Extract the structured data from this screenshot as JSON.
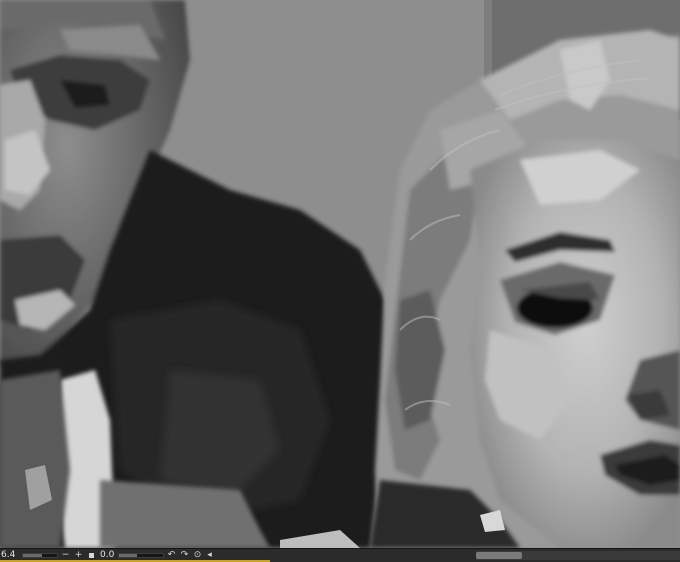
{
  "canvas": {
    "description_icon": "painting-canvas",
    "colors": {
      "background_wall": "#8d8d8d",
      "coat": "#1b1b1b",
      "face_light": "#c6c6c6"
    }
  },
  "statusbar": {
    "zoom_value": "6.4",
    "rotation_value": "0.0",
    "zoom_fill": 0.55,
    "icons": {
      "zoom_out": "minus-icon",
      "zoom_in": "plus-icon",
      "fit": "fit-square-icon",
      "rotate_left": "rotate-ccw-icon",
      "rotate_right": "rotate-cw-icon",
      "reset": "reset-icon",
      "flip": "flip-icon"
    },
    "accent_color": "#c9a227"
  }
}
